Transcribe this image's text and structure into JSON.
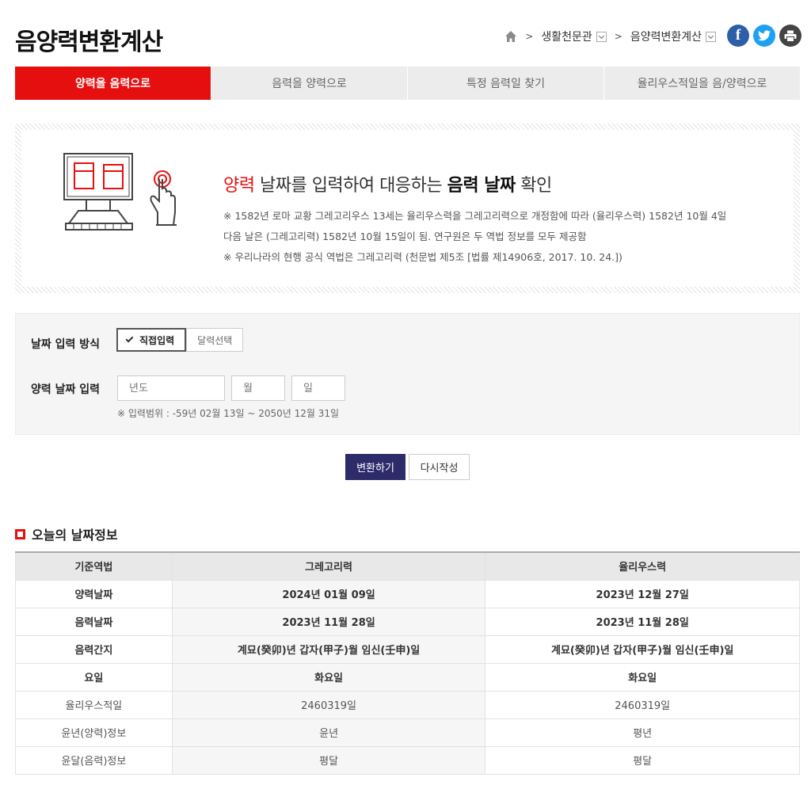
{
  "page_title": "음양력변환계산",
  "breadcrumb": {
    "items": [
      "생활천문관",
      "음양력변환계산"
    ]
  },
  "social": {
    "facebook": "f",
    "twitter": "t",
    "print": "p"
  },
  "tabs": [
    {
      "label": "양력을 음력으로",
      "active": true
    },
    {
      "label": "음력을 양력으로",
      "active": false
    },
    {
      "label": "특정 음력일 찾기",
      "active": false
    },
    {
      "label": "율리우스적일을 음/양력으로",
      "active": false
    }
  ],
  "info": {
    "headline_red": "양력",
    "headline_mid": " 날짜를 입력하여 대응하는 ",
    "headline_bold": "음력 날짜",
    "headline_end": " 확인",
    "note1": "※ 1582년 로마 교황 그레고리우스 13세는 율리우스력을 그레고리력으로 개정함에 따라 (율리우스력) 1582년 10월 4일",
    "note2": "다음 날은 (그레고리력) 1582년 10월 15일이 됨. 연구원은 두 역법 정보를 모두 제공함",
    "note3": "※ 우리나라의 현행 공식 역법은 그레고리력 (천문법 제5조 [법률 제14906호, 2017. 10. 24.])"
  },
  "form": {
    "method_label": "날짜 입력 방식",
    "method_direct": "직접입력",
    "method_calendar": "달력선택",
    "date_label": "양력 날짜 입력",
    "year_placeholder": "년도",
    "month_placeholder": "월",
    "day_placeholder": "일",
    "range_note": "※ 입력범위 : -59년 02월 13일 ~ 2050년 12월 31일"
  },
  "buttons": {
    "convert": "변환하기",
    "reset": "다시작성"
  },
  "today": {
    "section_title": "오늘의 날짜정보",
    "headers": [
      "기준역법",
      "그레고리력",
      "율리우스력"
    ],
    "rows": [
      [
        "양력날짜",
        "2024년 01월 09일",
        "2023년 12월 27일"
      ],
      [
        "음력날짜",
        "2023년 11월 28일",
        "2023년 11월 28일"
      ],
      [
        "음력간지",
        "계묘(癸卯)년 갑자(甲子)월 임신(壬申)일",
        "계묘(癸卯)년 갑자(甲子)월 임신(壬申)일"
      ],
      [
        "요일",
        "화요일",
        "화요일"
      ],
      [
        "율리우스적일",
        "2460319일",
        "2460319일"
      ],
      [
        "윤년(양력)정보",
        "윤년",
        "평년"
      ],
      [
        "윤달(음력)정보",
        "평달",
        "평달"
      ]
    ]
  },
  "colors": {
    "accent_red": "#e60f0f",
    "primary_button": "#2e2b6b"
  }
}
